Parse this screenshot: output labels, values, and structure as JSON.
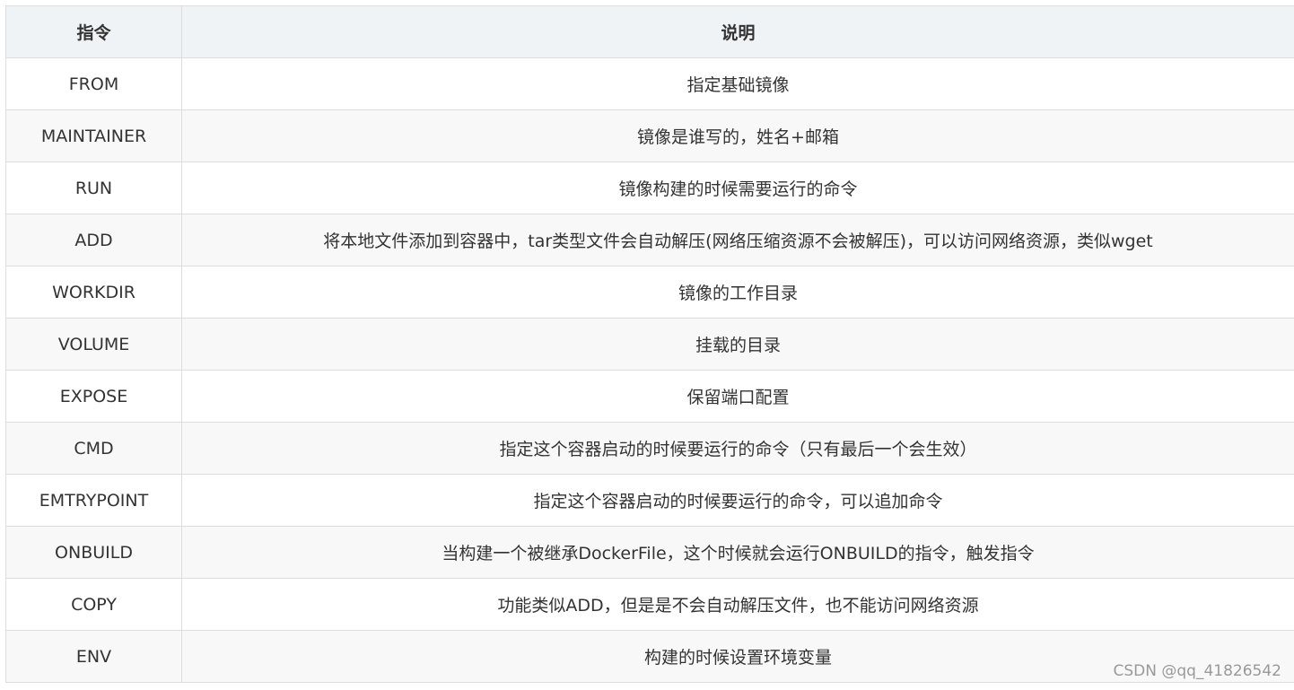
{
  "table": {
    "headers": [
      "指令",
      "说明"
    ],
    "rows": [
      {
        "command": "FROM",
        "description": "指定基础镜像"
      },
      {
        "command": "MAINTAINER",
        "description": "镜像是谁写的，姓名+邮箱"
      },
      {
        "command": "RUN",
        "description": "镜像构建的时候需要运行的命令"
      },
      {
        "command": "ADD",
        "description": "将本地文件添加到容器中，tar类型文件会自动解压(网络压缩资源不会被解压)，可以访问网络资源，类似wget"
      },
      {
        "command": "WORKDIR",
        "description": "镜像的工作目录"
      },
      {
        "command": "VOLUME",
        "description": "挂载的目录"
      },
      {
        "command": "EXPOSE",
        "description": "保留端口配置"
      },
      {
        "command": "CMD",
        "description": "指定这个容器启动的时候要运行的命令（只有最后一个会生效）"
      },
      {
        "command": "EMTRYPOINT",
        "description": "指定这个容器启动的时候要运行的命令，可以追加命令"
      },
      {
        "command": "ONBUILD",
        "description": "当构建一个被继承DockerFile，这个时候就会运行ONBUILD的指令，触发指令"
      },
      {
        "command": "COPY",
        "description": "功能类似ADD，但是是不会自动解压文件，也不能访问网络资源"
      },
      {
        "command": "ENV",
        "description": "构建的时候设置环境变量"
      }
    ]
  },
  "watermark": "CSDN @qq_41826542",
  "colors": {
    "header_bg": "#eff3f5",
    "stripe_bg": "#f8f8f8",
    "border": "#dddddd",
    "text": "#333333"
  }
}
